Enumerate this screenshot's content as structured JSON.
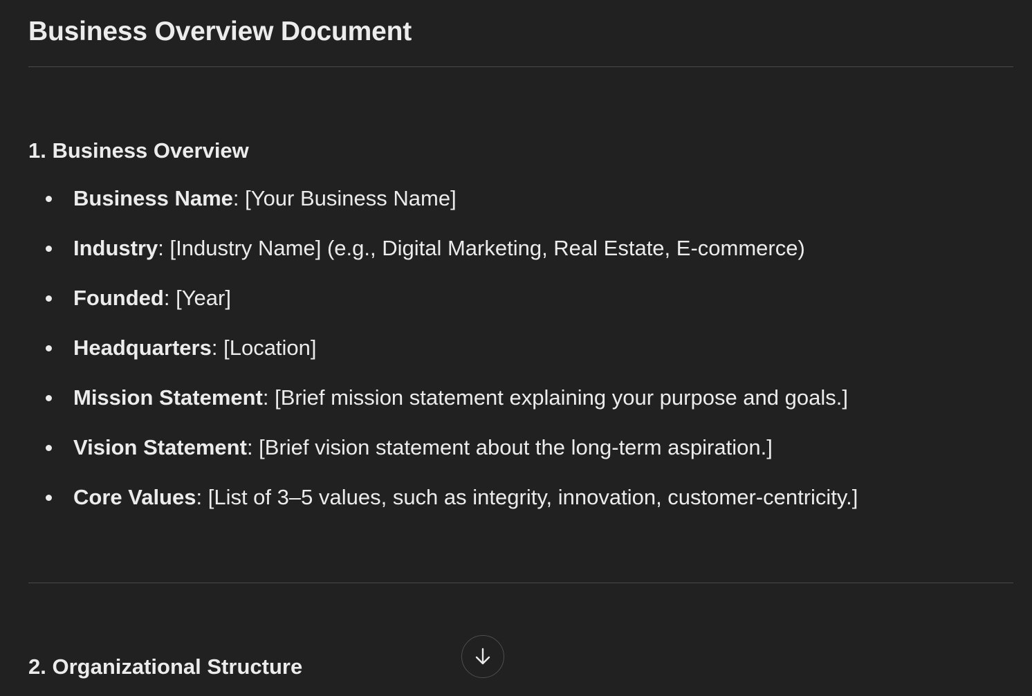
{
  "document": {
    "title": "Business Overview Document",
    "sections": [
      {
        "heading": "1. Business Overview",
        "items": [
          {
            "key": "Business Name",
            "sep": ": ",
            "value": "[Your Business Name]"
          },
          {
            "key": "Industry",
            "sep": ": ",
            "value": "[Industry Name] (e.g., Digital Marketing, Real Estate, E-commerce)"
          },
          {
            "key": "Founded",
            "sep": ": ",
            "value": "[Year]"
          },
          {
            "key": "Headquarters",
            "sep": ": ",
            "value": "[Location]"
          },
          {
            "key": "Mission Statement",
            "sep": ": ",
            "value": "[Brief mission statement explaining your purpose and goals.]"
          },
          {
            "key": "Vision Statement",
            "sep": ": ",
            "value": "[Brief vision statement about the long-term aspiration.]"
          },
          {
            "key": "Core Values",
            "sep": ": ",
            "value": "[List of 3–5 values, such as integrity, innovation, customer-centricity.]"
          }
        ]
      },
      {
        "heading": "2. Organizational Structure"
      }
    ]
  },
  "scroll_button": {
    "icon": "arrow-down-icon"
  },
  "colors": {
    "background": "#212121",
    "text": "#ececec",
    "divider": "#4a4a4a"
  }
}
